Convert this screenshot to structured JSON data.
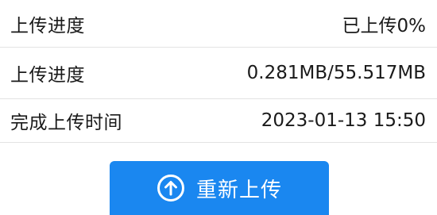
{
  "rows": [
    {
      "label": "上传进度",
      "value": "已上传0%"
    },
    {
      "label": "上传进度",
      "value": "0.281MB/55.517MB"
    },
    {
      "label": "完成上传时间",
      "value": "2023-01-13 15:50"
    }
  ],
  "reupload_button": {
    "label": "重新上传",
    "icon": "arrow-up-circle-icon"
  },
  "colors": {
    "button_bg": "#1a87f0",
    "divider": "#e3e3e3",
    "text": "#1a1a1a"
  }
}
